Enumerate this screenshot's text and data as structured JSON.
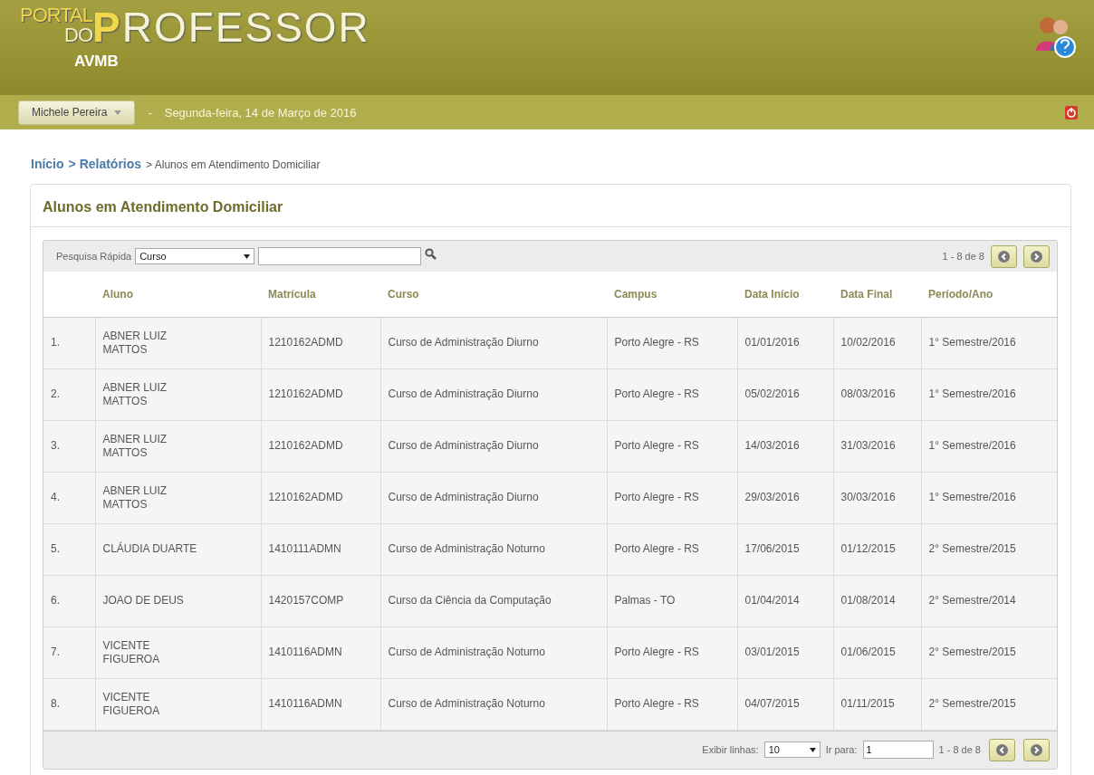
{
  "header": {
    "logo_small_top": "PORTAL",
    "logo_small_bottom": "DO",
    "logo_title": "PROFESSOR",
    "subtitle": "AVMB"
  },
  "nav": {
    "user": "Michele Pereira",
    "separator": "-",
    "date": "Segunda-feira, 14 de Março de 2016"
  },
  "breadcrumb": [
    {
      "label": "Início",
      "link": true
    },
    {
      "label": "> Relatórios",
      "link": true
    },
    {
      "label": "> Alunos em Atendimento Domiciliar",
      "link": false
    }
  ],
  "panel": {
    "title": "Alunos em Atendimento Domiciliar"
  },
  "toolbar": {
    "label": "Pesquisa Rápida",
    "filter": "Curso",
    "range": "1 - 8 de 8"
  },
  "table": {
    "columns": [
      "",
      "Aluno",
      "Matrícula",
      "Curso",
      "Campus",
      "Data Início",
      "Data Final",
      "Período/Ano"
    ],
    "rows": [
      [
        "1.",
        "ABNER LUIZ MATTOS",
        "1210162ADMD",
        "Curso de Administração Diurno",
        "Porto Alegre - RS",
        "01/01/2016",
        "10/02/2016",
        "1° Semestre/2016"
      ],
      [
        "2.",
        "ABNER LUIZ MATTOS",
        "1210162ADMD",
        "Curso de Administração Diurno",
        "Porto Alegre - RS",
        "05/02/2016",
        "08/03/2016",
        "1° Semestre/2016"
      ],
      [
        "3.",
        "ABNER LUIZ MATTOS",
        "1210162ADMD",
        "Curso de Administração Diurno",
        "Porto Alegre - RS",
        "14/03/2016",
        "31/03/2016",
        "1° Semestre/2016"
      ],
      [
        "4.",
        "ABNER LUIZ MATTOS",
        "1210162ADMD",
        "Curso de Administração Diurno",
        "Porto Alegre - RS",
        "29/03/2016",
        "30/03/2016",
        "1° Semestre/2016"
      ],
      [
        "5.",
        "CLÁUDIA DUARTE",
        "1410111ADMN",
        "Curso de Administração Noturno",
        "Porto Alegre - RS",
        "17/06/2015",
        "01/12/2015",
        "2° Semestre/2015"
      ],
      [
        "6.",
        "JOAO DE DEUS",
        "1420157COMP",
        "Curso da Ciência da Computação",
        "Palmas - TO",
        "01/04/2014",
        "01/08/2014",
        "2° Semestre/2014"
      ],
      [
        "7.",
        "VICENTE FIGUEROA",
        "1410116ADMN",
        "Curso de Administração Noturno",
        "Porto Alegre - RS",
        "03/01/2015",
        "01/06/2015",
        "2° Semestre/2015"
      ],
      [
        "8.",
        "VICENTE FIGUEROA",
        "1410116ADMN",
        "Curso de Administração Noturno",
        "Porto Alegre - RS",
        "04/07/2015",
        "01/11/2015",
        "2° Semestre/2015"
      ]
    ]
  },
  "footer": {
    "rows_label": "Exibir linhas:",
    "rows_value": "10",
    "goto_label": "Ir para:",
    "goto_value": "1",
    "range": "1 - 8 de 8"
  }
}
